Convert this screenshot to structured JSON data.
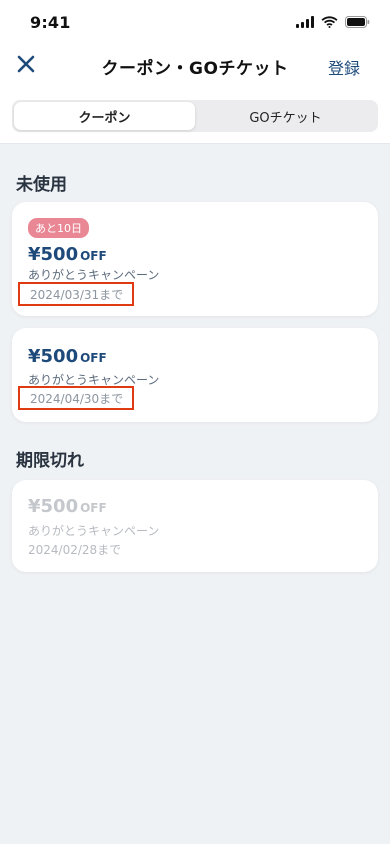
{
  "status_bar": {
    "time": "9:41"
  },
  "header": {
    "title": "クーポン・GOチケット",
    "register_label": "登録"
  },
  "tabs": [
    {
      "label": "クーポン",
      "selected": true
    },
    {
      "label": "GOチケット",
      "selected": false
    }
  ],
  "sections": {
    "unused": {
      "title": "未使用",
      "coupons": [
        {
          "badge": "あと10日",
          "amount": "¥500",
          "unit": "OFF",
          "campaign": "ありがとうキャンペーン",
          "expiry": "2024/03/31まで"
        },
        {
          "amount": "¥500",
          "unit": "OFF",
          "campaign": "ありがとうキャンペーン",
          "expiry": "2024/04/30まで"
        }
      ]
    },
    "expired": {
      "title": "期限切れ",
      "coupons": [
        {
          "amount": "¥500",
          "unit": "OFF",
          "campaign": "ありがとうキャンペーン",
          "expiry": "2024/02/28まで"
        }
      ]
    }
  },
  "colors": {
    "accent": "#1d4a7a",
    "badge": "#e98794",
    "highlight_border": "#e03a12",
    "background": "#eff2f5"
  },
  "icons": [
    "cellular-signal-icon",
    "wifi-icon",
    "battery-icon",
    "close-icon"
  ]
}
